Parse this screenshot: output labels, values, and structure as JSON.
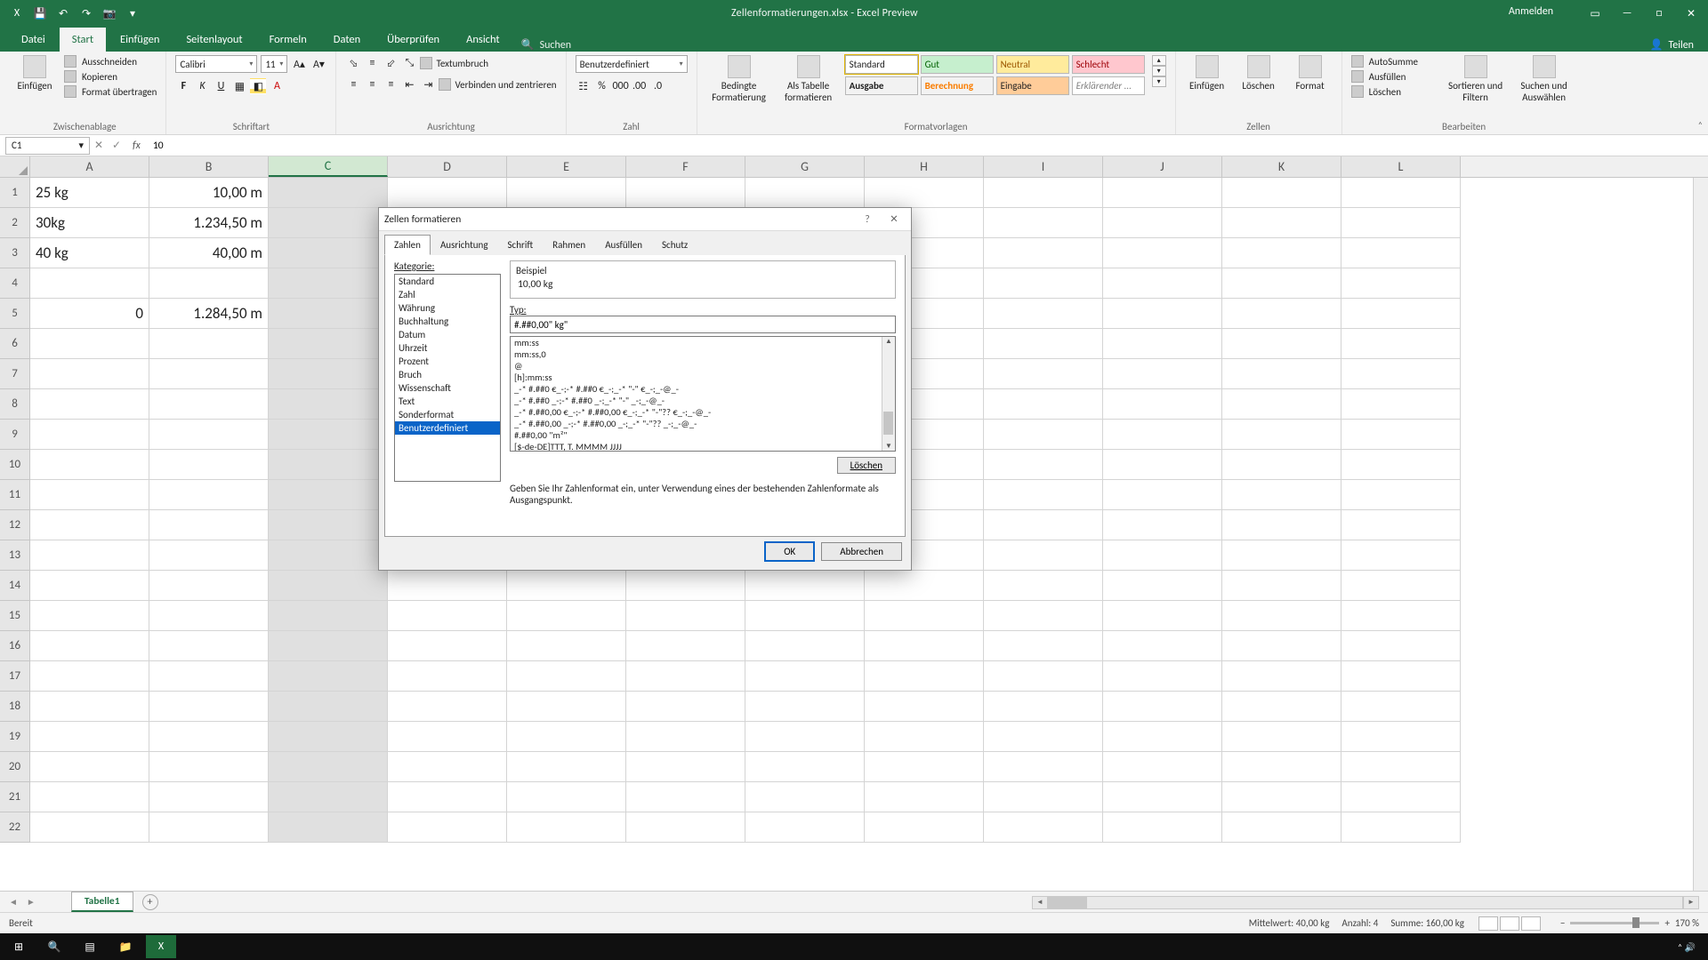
{
  "titlebar": {
    "doc_title": "Zellenformatierungen.xlsx - Excel Preview",
    "signin": "Anmelden"
  },
  "qat": {
    "excel": "X",
    "save": "💾",
    "undo": "↶",
    "redo": "↷",
    "more": "▾"
  },
  "tabs": {
    "file": "Datei",
    "home": "Start",
    "insert": "Einfügen",
    "pagelayout": "Seitenlayout",
    "formulas": "Formeln",
    "data": "Daten",
    "review": "Überprüfen",
    "view": "Ansicht",
    "search_icon": "🔍",
    "search_label": "Suchen",
    "share_icon": "👤",
    "share_label": "Teilen"
  },
  "ribbon": {
    "clipboard": {
      "paste": "Einfügen",
      "cut": "Ausschneiden",
      "copy": "Kopieren",
      "painter": "Format übertragen",
      "gname": "Zwischenablage"
    },
    "font": {
      "name": "Calibri",
      "size": "11",
      "gname": "Schriftart"
    },
    "alignment": {
      "wrap": "Textumbruch",
      "merge": "Verbinden und zentrieren",
      "gname": "Ausrichtung"
    },
    "number": {
      "format": "Benutzerdefiniert",
      "gname": "Zahl"
    },
    "styles": {
      "cond": "Bedingte Formatierung",
      "table": "Als Tabelle formatieren",
      "tiles": {
        "standard": "Standard",
        "gut": "Gut",
        "neutral": "Neutral",
        "schlecht": "Schlecht",
        "ausgabe": "Ausgabe",
        "berechnung": "Berechnung",
        "eingabe": "Eingabe",
        "erkl": "Erklärender ..."
      },
      "gname": "Formatvorlagen"
    },
    "cells": {
      "insert": "Einfügen",
      "delete": "Löschen",
      "format": "Format",
      "gname": "Zellen"
    },
    "editing": {
      "autosum": "AutoSumme",
      "fill": "Ausfüllen",
      "clear": "Löschen",
      "sort": "Sortieren und Filtern",
      "find": "Suchen und Auswählen",
      "gname": "Bearbeiten"
    }
  },
  "fx": {
    "namebox": "C1",
    "chev": "▾",
    "x": "✕",
    "check": "✓",
    "fx": "fx",
    "formula": "10"
  },
  "grid": {
    "cols": [
      "A",
      "B",
      "C",
      "D",
      "E",
      "F",
      "G",
      "H",
      "I",
      "J",
      "K",
      "L"
    ],
    "rows": [
      "1",
      "2",
      "3",
      "4",
      "5",
      "6",
      "7",
      "8",
      "9",
      "10",
      "11",
      "12",
      "13",
      "14",
      "15",
      "16",
      "17",
      "18",
      "19",
      "20",
      "21",
      "22"
    ],
    "data": {
      "A1": "25 kg",
      "B1": "10,00 m",
      "A2": "30kg",
      "B2": "1.234,50 m",
      "A3": "40 kg",
      "B3": "40,00 m",
      "A5": "0",
      "B5": "1.284,50 m"
    }
  },
  "wstab": {
    "nav_l": "◄",
    "nav_r": "►",
    "name": "Tabelle1",
    "add": "+"
  },
  "status": {
    "ready": "Bereit",
    "agg": {
      "mw_l": "Mittelwert:",
      "mw_v": "40,00 kg",
      "anz_l": "Anzahl:",
      "anz_v": "4",
      "sum_l": "Summe:",
      "sum_v": "160,00 kg"
    },
    "zoom_minus": "−",
    "zoom_plus": "+",
    "zoom": "170 %"
  },
  "dialog": {
    "title": "Zellen formatieren",
    "help": "?",
    "close": "✕",
    "tabs": [
      "Zahlen",
      "Ausrichtung",
      "Schrift",
      "Rahmen",
      "Ausfüllen",
      "Schutz"
    ],
    "cat_label": "Kategorie:",
    "categories": [
      "Standard",
      "Zahl",
      "Währung",
      "Buchhaltung",
      "Datum",
      "Uhrzeit",
      "Prozent",
      "Bruch",
      "Wissenschaft",
      "Text",
      "Sonderformat",
      "Benutzerdefiniert"
    ],
    "sample_label": "Beispiel",
    "sample_value": "10,00 kg",
    "typ_label": "Typ:",
    "typ_value": "#.##0,00\" kg\"",
    "formats": [
      "mm:ss",
      "mm:ss,0",
      "@",
      "[h]:mm:ss",
      "_-* #.##0 €_-;-* #.##0 €_-;_-* \"-\" €_-;_-@_-",
      "_-* #.##0 _-;-* #.##0 _-;_-* \"-\" _-;_-@_-",
      "_-* #.##0,00 €_-;-* #.##0,00 €_-;_-* \"-\"?? €_-;_-@_-",
      "_-* #.##0,00 _-;-* #.##0,00 _-;_-* \"-\"?? _-;_-@_-",
      "#.##0,00 \"m²\"",
      "[$-de-DE]TTT, T. MMMM JJJJ",
      "#.##0,00\" kg\""
    ],
    "selected_format_index": 10,
    "delete": "Löschen",
    "hint": "Geben Sie Ihr Zahlenformat ein, unter Verwendung eines der bestehenden Zahlenformate als Ausgangspunkt.",
    "ok": "OK",
    "cancel": "Abbrechen",
    "scroll_up": "▲",
    "scroll_down": "▼"
  },
  "taskbar": {
    "win": "⊞",
    "search": "🔍",
    "tasks": "▤",
    "files": "📁",
    "excel": "X",
    "time": "",
    "date": ""
  }
}
